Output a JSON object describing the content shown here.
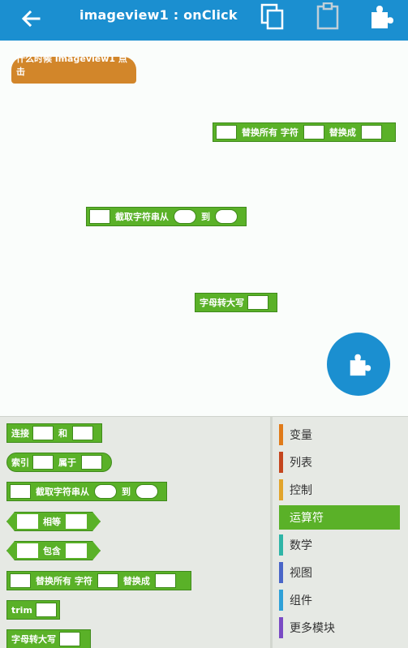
{
  "header": {
    "title": "imageview1 : onClick"
  },
  "canvas_blocks": {
    "event_label": "什么时候  imageview1 点击",
    "replace_all": {
      "l1": "替换所有 字符",
      "l2": "替换成"
    },
    "substring": {
      "l1": "截取字符串从",
      "l2": "到"
    },
    "uppercase": {
      "l1": "字母转大写"
    }
  },
  "palette": {
    "join": {
      "l1": "连接",
      "l2": "和"
    },
    "index": {
      "l1": "索引",
      "l2": "属于"
    },
    "substring": {
      "l1": "截取字符串从",
      "l2": "到"
    },
    "equals": {
      "l1": "相等"
    },
    "contains": {
      "l1": "包含"
    },
    "replace_all": {
      "l1": "替换所有 字符",
      "l2": "替换成"
    },
    "trim": {
      "l1": "trim"
    },
    "uppercase": {
      "l1": "字母转大写"
    }
  },
  "categories": [
    {
      "label": "变量",
      "color": "#e07b1a"
    },
    {
      "label": "列表",
      "color": "#c4461e"
    },
    {
      "label": "控制",
      "color": "#e2a42b"
    },
    {
      "label": "运算符",
      "color": "#5ab128",
      "active": true
    },
    {
      "label": "数学",
      "color": "#2fb5a7"
    },
    {
      "label": "视图",
      "color": "#4a66c8"
    },
    {
      "label": "组件",
      "color": "#2fa1d8"
    },
    {
      "label": "更多模块",
      "color": "#7a4bc4"
    }
  ],
  "colors": {
    "header_bg": "#1b8fd0",
    "block_green": "#5ab128",
    "event_orange": "#d2862a"
  }
}
